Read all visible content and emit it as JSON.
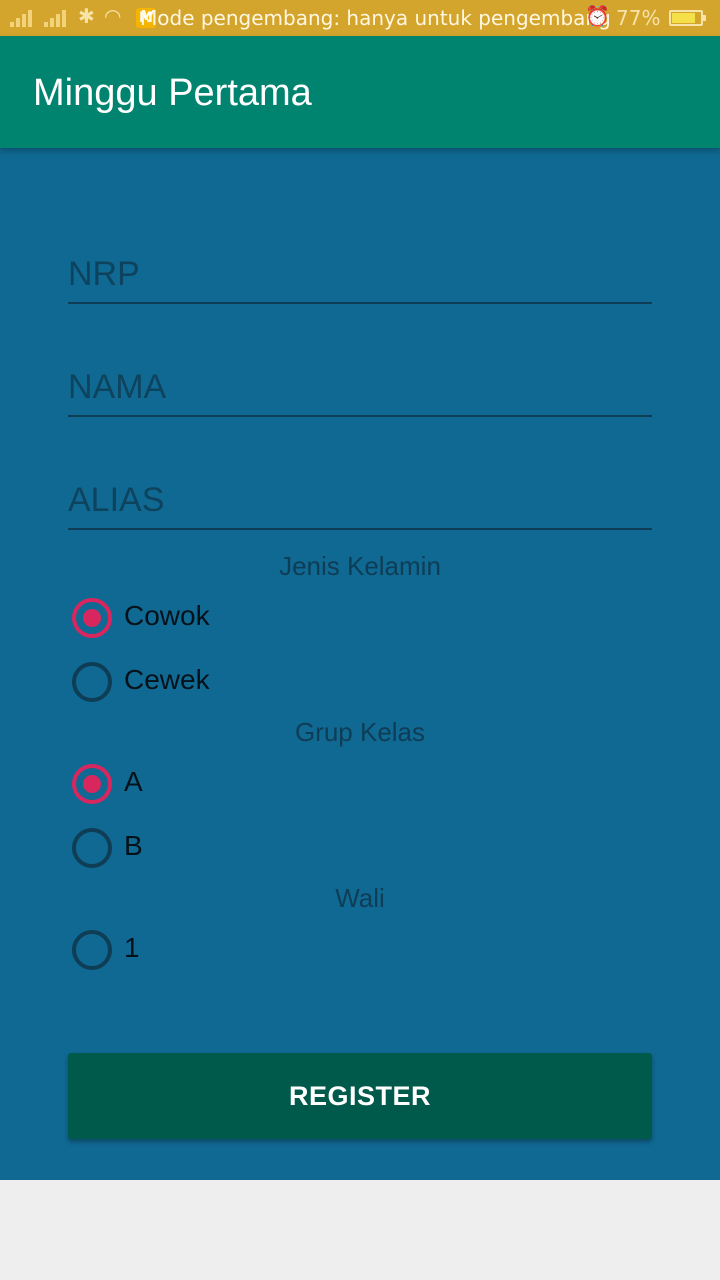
{
  "status_bar": {
    "notice": "Mode pengembang: hanya untuk pengembang",
    "battery_percent": "77%",
    "badge": "M",
    "icons": [
      "signal-icon",
      "signal-icon",
      "notification-icon",
      "wifi-icon",
      "app-badge-icon",
      "cat-icon",
      "upload-icon",
      "alarm-icon",
      "battery-icon"
    ]
  },
  "app_bar": {
    "title": "Minggu Pertama",
    "color": "#00836f"
  },
  "form": {
    "background": "#106993",
    "nrp_placeholder": "NRP",
    "nama_placeholder": "NAMA",
    "alias_placeholder": "ALIAS",
    "gender": {
      "label": "Jenis Kelamin",
      "options": [
        {
          "label": "Cowok",
          "checked": true
        },
        {
          "label": "Cewek",
          "checked": false
        }
      ]
    },
    "class_group": {
      "label": "Grup Kelas",
      "options": [
        {
          "label": "A",
          "checked": true
        },
        {
          "label": "B",
          "checked": false
        }
      ]
    },
    "guardian": {
      "label": "Wali",
      "options": [
        {
          "label": "1",
          "checked": false
        }
      ]
    },
    "register_label": "REGISTER",
    "accent": "#d8265e"
  }
}
